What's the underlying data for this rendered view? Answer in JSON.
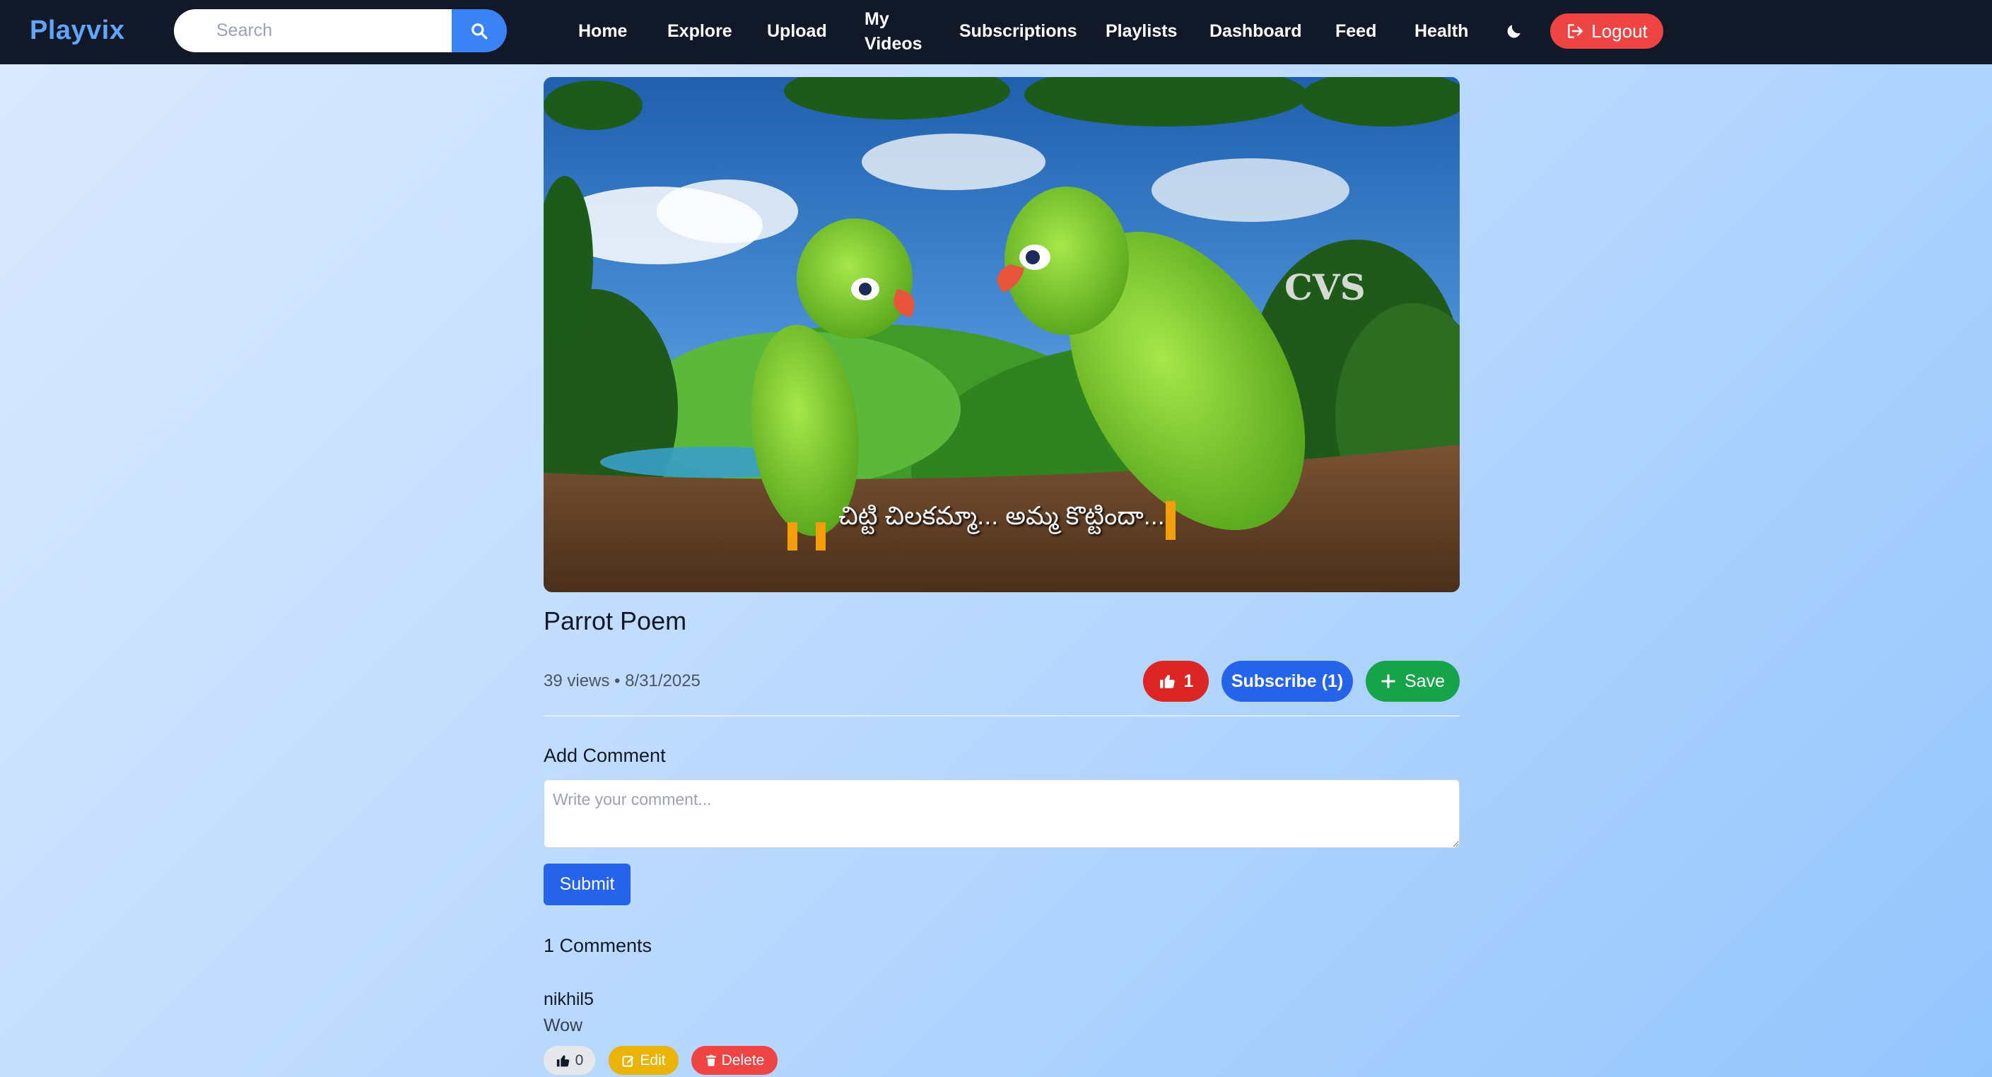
{
  "app": {
    "brand": "Playvix"
  },
  "search": {
    "placeholder": "Search",
    "value": ""
  },
  "nav": {
    "items": [
      {
        "label": "Home"
      },
      {
        "label": "Explore"
      },
      {
        "label": "Upload"
      },
      {
        "label": "My Videos"
      },
      {
        "label": "Subscriptions"
      },
      {
        "label": "Playlists"
      },
      {
        "label": "Dashboard"
      },
      {
        "label": "Feed"
      },
      {
        "label": "Health"
      }
    ],
    "theme_icon": "moon-icon",
    "logout_label": "Logout"
  },
  "video": {
    "title": "Parrot Poem",
    "views": "39 views",
    "date": "8/31/2025",
    "meta": "39 views • 8/31/2025",
    "watermark": "CVS",
    "subtitle": "చిట్టి చిలకమ్మా... అమ్మ కొట్టిందా...",
    "likes": "1",
    "subscribe_label": "Subscribe (1)",
    "save_label": "Save"
  },
  "comments": {
    "add_heading": "Add Comment",
    "input_placeholder": "Write your comment...",
    "input_value": "",
    "submit_label": "Submit",
    "count_heading": "1 Comments",
    "items": [
      {
        "user": "nikhil5",
        "text": "Wow",
        "likes": "0",
        "edit_label": "Edit",
        "delete_label": "Delete"
      }
    ]
  },
  "colors": {
    "navbar": "#111827",
    "brand": "#60a5fa",
    "like": "#dc2626",
    "subscribe": "#2563eb",
    "save": "#16a34a",
    "logout": "#ef4444",
    "edit": "#eab308",
    "delete": "#ef4444"
  }
}
